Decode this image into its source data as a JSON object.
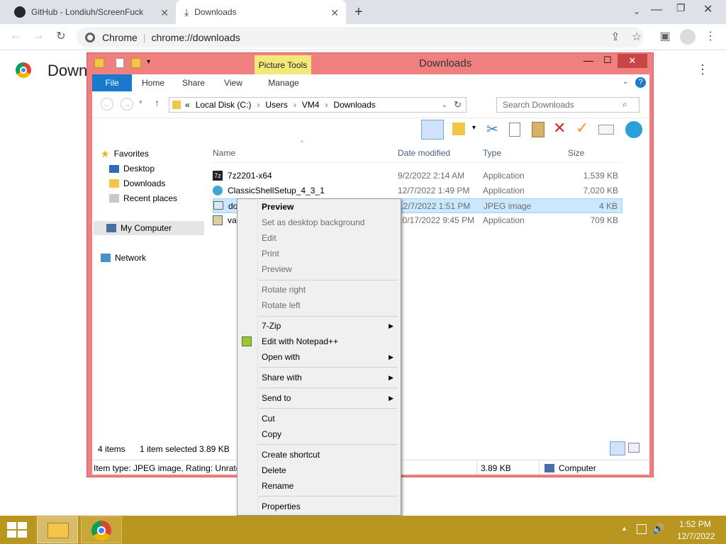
{
  "chrome": {
    "tabs": [
      {
        "title": "GitHub - Londiuh/ScreenFuck",
        "icon": "github-icon"
      },
      {
        "title": "Downloads",
        "icon": "download-icon"
      }
    ],
    "omnibox": {
      "site": "Chrome",
      "url": "chrome://downloads"
    },
    "page_title": "Down"
  },
  "explorer": {
    "title": "Downloads",
    "picture_tools": "Picture Tools",
    "ribbon_tabs": [
      "File",
      "Home",
      "Share",
      "View",
      "Manage"
    ],
    "breadcrumb": [
      "Local Disk (C:)",
      "Users",
      "VM4",
      "Downloads"
    ],
    "breadcrumb_prefix": "«",
    "search_placeholder": "Search Downloads",
    "nav": {
      "favorites": "Favorites",
      "items": [
        "Desktop",
        "Downloads",
        "Recent places"
      ],
      "computer": "My Computer",
      "network": "Network"
    },
    "columns": [
      "Name",
      "Date modified",
      "Type",
      "Size"
    ],
    "files": [
      {
        "name": "7z2201-x64",
        "date": "9/2/2022 2:14 AM",
        "type": "Application",
        "size": "1,539 KB"
      },
      {
        "name": "ClassicShellSetup_4_3_1",
        "date": "12/7/2022 1:49 PM",
        "type": "Application",
        "size": "7,020 KB"
      },
      {
        "name": "download",
        "date": "12/7/2022 1:51 PM",
        "type": "JPEG image",
        "size": "4 KB"
      },
      {
        "name": "vac467",
        "date": "10/17/2022 9:45 PM",
        "type": "Application",
        "size": "709 KB"
      }
    ],
    "status": {
      "items": "4 items",
      "selected": "1 item selected",
      "size": "3.89 KB"
    },
    "details": {
      "type": "Item type: JPEG image, Rating: Unrated",
      "size": "3.89 KB",
      "location": "Computer"
    }
  },
  "context_menu": {
    "groups": [
      [
        {
          "label": "Preview",
          "bold": true
        },
        {
          "label": "Set as desktop background"
        },
        {
          "label": "Edit"
        },
        {
          "label": "Print"
        },
        {
          "label": "Preview"
        }
      ],
      [
        {
          "label": "Rotate right"
        },
        {
          "label": "Rotate left"
        }
      ],
      [
        {
          "label": "7-Zip",
          "sub": true
        },
        {
          "label": "Edit with Notepad++",
          "icon": "notepadpp-icon"
        },
        {
          "label": "Open with",
          "sub": true
        }
      ],
      [
        {
          "label": "Share with",
          "sub": true
        }
      ],
      [
        {
          "label": "Send to",
          "sub": true
        }
      ],
      [
        {
          "label": "Cut"
        },
        {
          "label": "Copy"
        }
      ],
      [
        {
          "label": "Create shortcut"
        },
        {
          "label": "Delete"
        },
        {
          "label": "Rename"
        }
      ],
      [
        {
          "label": "Properties"
        }
      ]
    ]
  },
  "taskbar": {
    "time": "1:52 PM",
    "date": "12/7/2022"
  }
}
